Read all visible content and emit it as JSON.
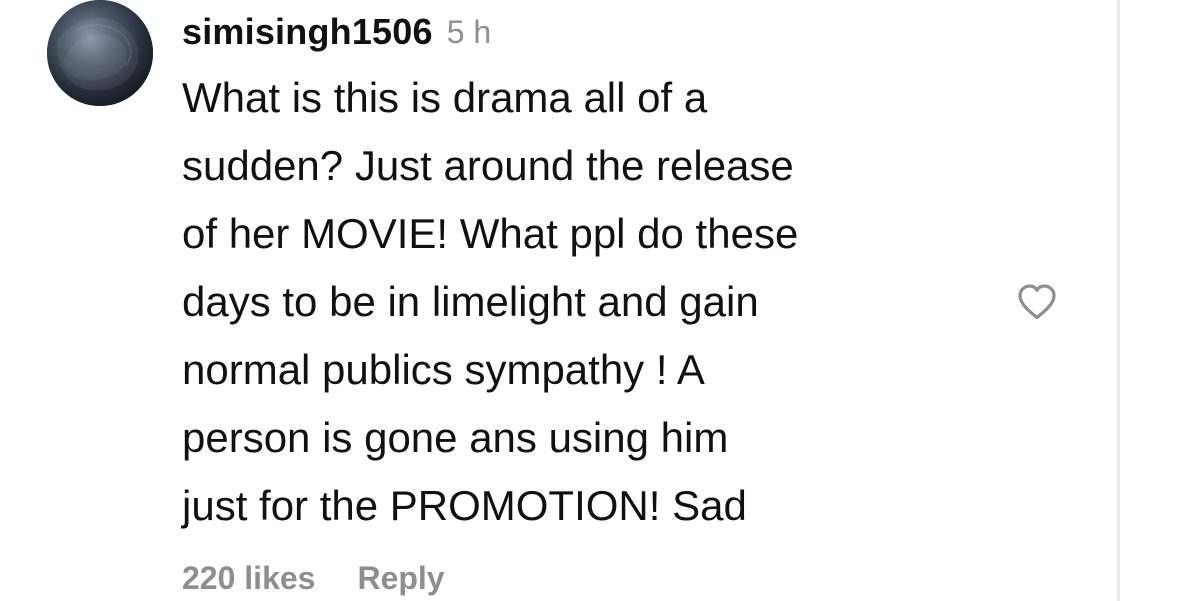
{
  "comment": {
    "username": "simisingh1506",
    "time": "5 h",
    "text": "What is this is drama all of a\nsudden? Just around the release\nof her MOVIE! What ppl do these\ndays to be in limelight and gain\nnormal publics sympathy ! A\nperson is gone ans using him\njust for the PROMOTION! Sad",
    "likes": "220 likes",
    "reply_label": "Reply"
  },
  "icons": {
    "like": "heart-outline-icon",
    "avatar": "profile-avatar"
  },
  "colors": {
    "text": "#111111",
    "muted": "#8e8e8e",
    "divider": "#e8e8e8"
  }
}
